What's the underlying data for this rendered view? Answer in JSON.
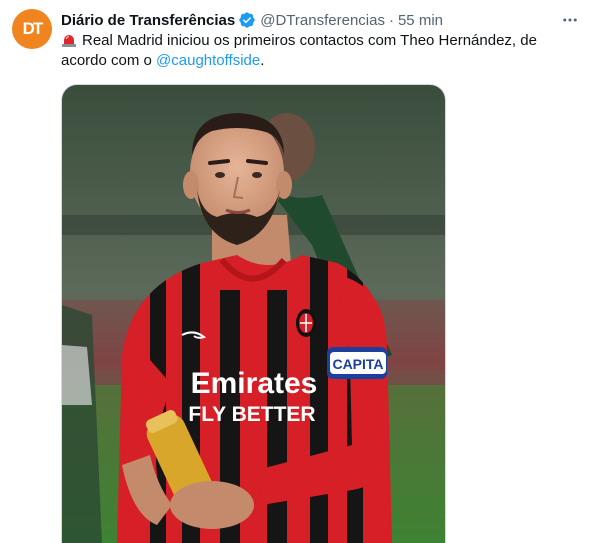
{
  "author": {
    "avatar_text": "DT",
    "display_name": "Diário de Transferências",
    "handle": "@DTransferencias",
    "separator": "·",
    "time": "55 min"
  },
  "tweet": {
    "text_before": "Real Madrid iniciou os primeiros contactos com Theo Hernández, de acordo com o ",
    "mention": "@caughtoffside",
    "text_after": "."
  },
  "media": {
    "sponsor_line1": "Emirates",
    "sponsor_line2": "FLY BETTER",
    "armband": "CAPITA"
  },
  "icons": {
    "verified": "verified-badge-icon",
    "siren": "rotating-light-icon",
    "more": "more-horizontal-icon"
  },
  "colors": {
    "accent": "#1d9bf0",
    "avatar_bg": "#f0841f",
    "muted_text": "#536471",
    "jersey_red": "#d61f26"
  }
}
